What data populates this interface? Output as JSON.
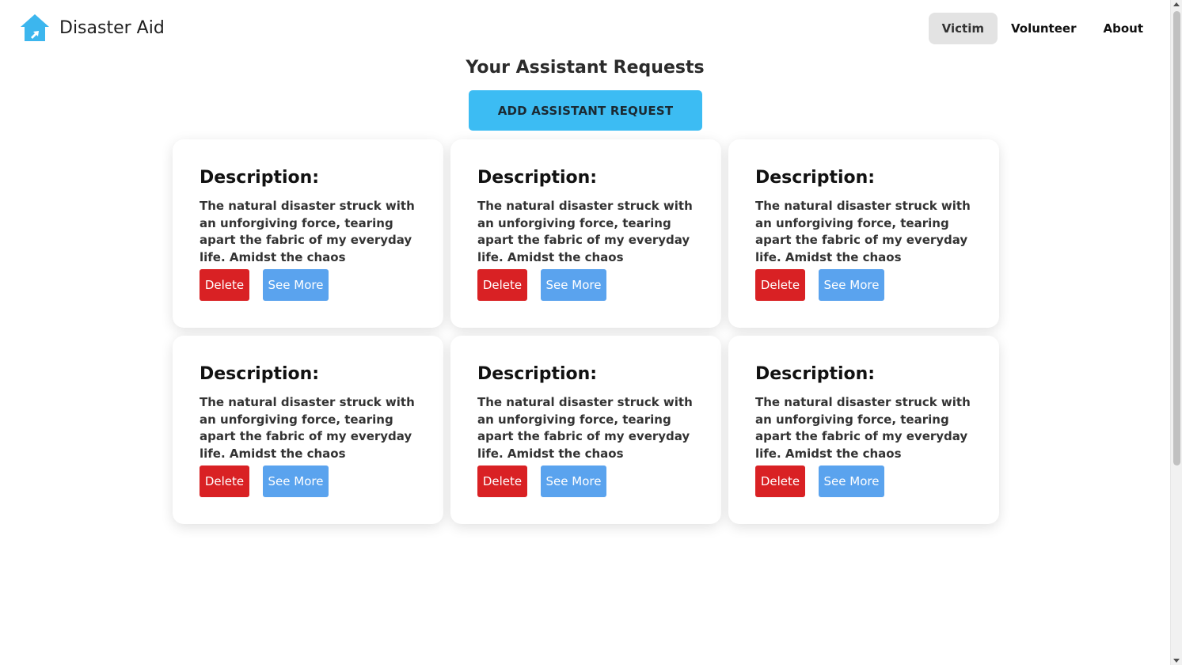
{
  "header": {
    "brand": "Disaster Aid",
    "logo_icon": "house-icon",
    "nav": [
      {
        "label": "Victim",
        "active": true
      },
      {
        "label": "Volunteer",
        "active": false
      },
      {
        "label": "About",
        "active": false
      }
    ]
  },
  "main": {
    "title": "Your Assistant Requests",
    "add_button_label": "ADD ASSISTANT REQUEST",
    "cards": [
      {
        "heading": "Description:",
        "text": "The natural disaster struck with an unforgiving force, tearing apart the fabric of my everyday life. Amidst the chaos",
        "delete_label": "Delete",
        "more_label": "See More"
      },
      {
        "heading": "Description:",
        "text": "The natural disaster struck with an unforgiving force, tearing apart the fabric of my everyday life. Amidst the chaos",
        "delete_label": "Delete",
        "more_label": "See More"
      },
      {
        "heading": "Description:",
        "text": "The natural disaster struck with an unforgiving force, tearing apart the fabric of my everyday life. Amidst the chaos",
        "delete_label": "Delete",
        "more_label": "See More"
      },
      {
        "heading": "Description:",
        "text": "The natural disaster struck with an unforgiving force, tearing apart the fabric of my everyday life. Amidst the chaos",
        "delete_label": "Delete",
        "more_label": "See More"
      },
      {
        "heading": "Description:",
        "text": "The natural disaster struck with an unforgiving force, tearing apart the fabric of my everyday life. Amidst the chaos",
        "delete_label": "Delete",
        "more_label": "See More"
      },
      {
        "heading": "Description:",
        "text": "The natural disaster struck with an unforgiving force, tearing apart the fabric of my everyday life. Amidst the chaos",
        "delete_label": "Delete",
        "more_label": "See More"
      }
    ]
  },
  "colors": {
    "accent": "#3cbcf3",
    "delete": "#d92124",
    "see_more": "#5aa3ee",
    "logo": "#3cb6ee"
  }
}
